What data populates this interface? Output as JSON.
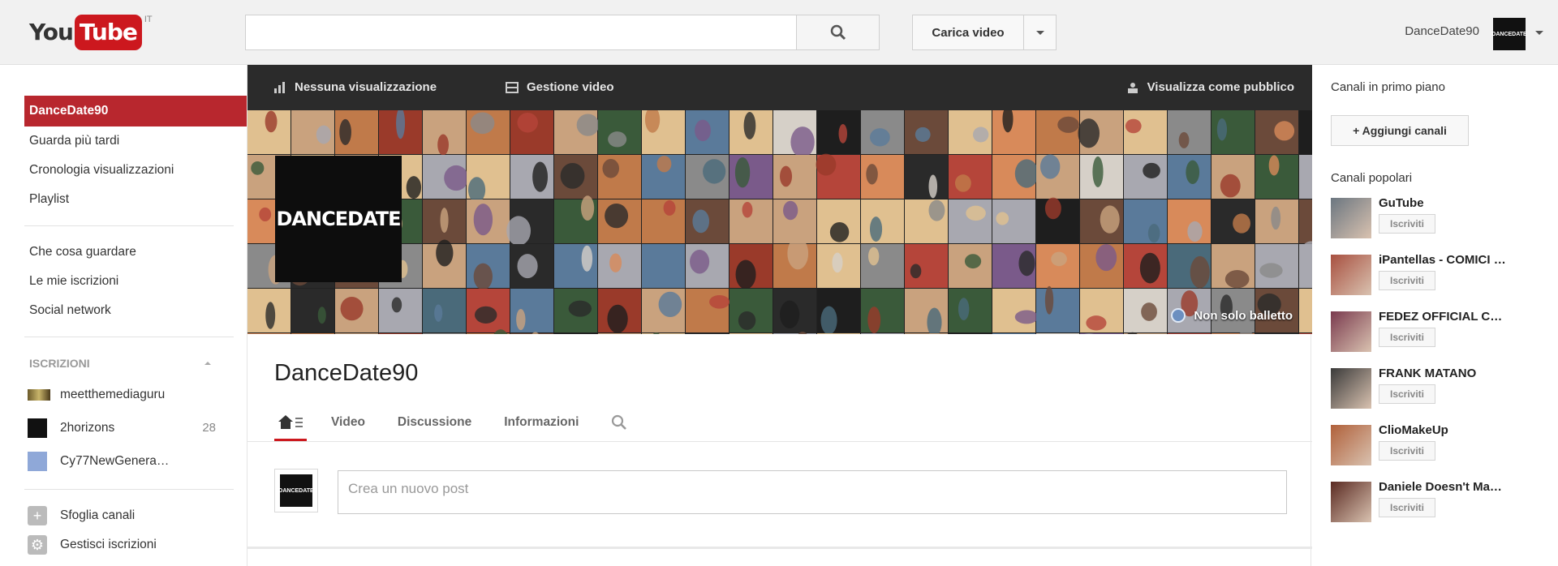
{
  "header": {
    "logo": {
      "you": "You",
      "tube": "Tube",
      "country": "IT"
    },
    "search": {
      "placeholder": "",
      "value": ""
    },
    "upload_label": "Carica video",
    "account_name": "DanceDate90",
    "account_avatar_text": "DANCEDATE"
  },
  "sidebar": {
    "nav": [
      {
        "label": "DanceDate90",
        "active": true
      },
      {
        "label": "Guarda più tardi"
      },
      {
        "label": "Cronologia visualizzazioni"
      },
      {
        "label": "Playlist"
      }
    ],
    "explore": [
      {
        "label": "Che cosa guardare"
      },
      {
        "label": "Le mie iscrizioni"
      },
      {
        "label": "Social network"
      }
    ],
    "subscriptions_heading": "ISCRIZIONI",
    "subscriptions": [
      {
        "label": "meetthemediaguru",
        "count": ""
      },
      {
        "label": "2horizons",
        "count": "28"
      },
      {
        "label": "Cy77NewGenera…",
        "count": ""
      }
    ],
    "tools": [
      {
        "label": "Sfoglia canali",
        "icon": "plus-icon"
      },
      {
        "label": "Gestisci iscrizioni",
        "icon": "gear-icon"
      }
    ]
  },
  "toolbar": {
    "views": "Nessuna visualizzazione",
    "manage": "Gestione video",
    "public_view": "Visualizza come pubblico"
  },
  "banner": {
    "logo_text": "DANCEDATE",
    "link_label": "Non solo balletto"
  },
  "channel": {
    "title": "DanceDate90",
    "tabs": [
      "Video",
      "Discussione",
      "Informazioni"
    ],
    "post_placeholder": "Crea un nuovo post"
  },
  "right": {
    "featured_heading": "Canali in primo piano",
    "add_channels": "+ Aggiungi canali",
    "popular_heading": "Canali popolari",
    "subscribe_label": "Iscriviti",
    "popular": [
      {
        "name": "GuTube",
        "color": "#6b7680"
      },
      {
        "name": "iPantellas - COMICI …",
        "color": "#a85040"
      },
      {
        "name": "FEDEZ OFFICIAL C…",
        "color": "#7a3a4e"
      },
      {
        "name": "FRANK MATANO",
        "color": "#3a3a3a"
      },
      {
        "name": "ClioMakeUp",
        "color": "#b0603a"
      },
      {
        "name": "Daniele Doesn't Ma…",
        "color": "#5a2a22"
      }
    ]
  },
  "colors": {
    "accent": "#cc181e",
    "active_nav": "#b8272e",
    "toolbar": "#2b2b2b"
  }
}
